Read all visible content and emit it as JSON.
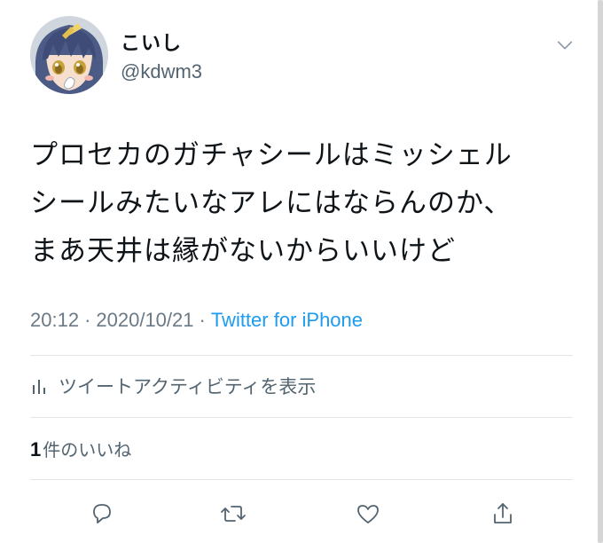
{
  "tweet": {
    "author": {
      "display_name": "こいし",
      "handle": "@kdwm3"
    },
    "text_lines": [
      "プロセカのガチャシールはミッシェル",
      "シールみたいなアレにはならんのか、",
      "まあ天井は縁がないからいいけど"
    ],
    "time": "20:12",
    "separator": "·",
    "date": "2020/10/21",
    "source": "Twitter for iPhone",
    "activity_label": "ツイートアクティビティを表示",
    "likes_count": "1",
    "likes_label": "件のいいね"
  },
  "icons": {
    "menu": "chevron-down-icon",
    "activity": "bar-chart-icon",
    "reply": "reply-icon",
    "retweet": "retweet-icon",
    "like": "heart-icon",
    "share": "share-icon"
  },
  "colors": {
    "link": "#1d9bf0",
    "secondary_text": "#536471",
    "divider": "#e1e6ea"
  }
}
